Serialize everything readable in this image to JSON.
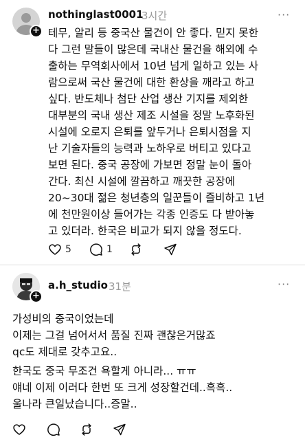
{
  "posts": [
    {
      "username": "nothinglast0001",
      "time": "3시간",
      "more": "···",
      "lines": [
        "테무, 알리 등 중국산 물건이 안 좋다. 믿지 못한",
        "다 그런 말들이 많은데 국내산 물건을 해외에 수",
        "출하는 무역회사에서 10년 넘게 일하고 있는 사",
        "람으로써 국산 물건에 대한 환상을 깨라고 하고",
        "싶다. 반도체나 첨단 산업 생산 기지를 제외한",
        "대부분의 국내 생산 제조 시설을 정말 노후화된",
        "시설에 오로지 은퇴를 앞두거나 은퇴시점을 지",
        "난 기술자들의 능력과 노하우로 버티고 있다고",
        "보면 된다. 중국 공장에 가보면 정말 눈이 돌아",
        "간다. 최신 시설에 깔끔하고 깨끗한 공장에",
        "20~30대 젊은 청년층의 일꾼들이 즐비하고 1년",
        "에 천만원이상 들어가는 각종 인증도 다 받아놓",
        "고 있더라. 한국은 비교가 되지 않을 정도다."
      ],
      "likes": "5",
      "comments": "1"
    },
    {
      "username": "a.h_studio",
      "time": "31분",
      "more": "···",
      "lines": [
        "가성비의 중국이었는데",
        "이제는 그걸 넘어서서 품질 진짜 괜찮은거많죠",
        "qc도 제대로 갖추고요.."
      ],
      "lines2": [
        "한국도 중국 무조건 욕할게 아니라... ㅠㅠ",
        "얘네 이제 이러다 한번 또 크게 성장할건데..흑흑..",
        "울나라 큰일났습니다..증말.."
      ]
    }
  ],
  "icons": {
    "like": "heart-icon",
    "comment": "comment-bubble-icon",
    "repost": "repost-icon",
    "share": "send-icon",
    "follow": "plus-icon"
  },
  "colors": {
    "text": "#101010",
    "secondary": "#999999",
    "divider": "#dcdcdc"
  }
}
